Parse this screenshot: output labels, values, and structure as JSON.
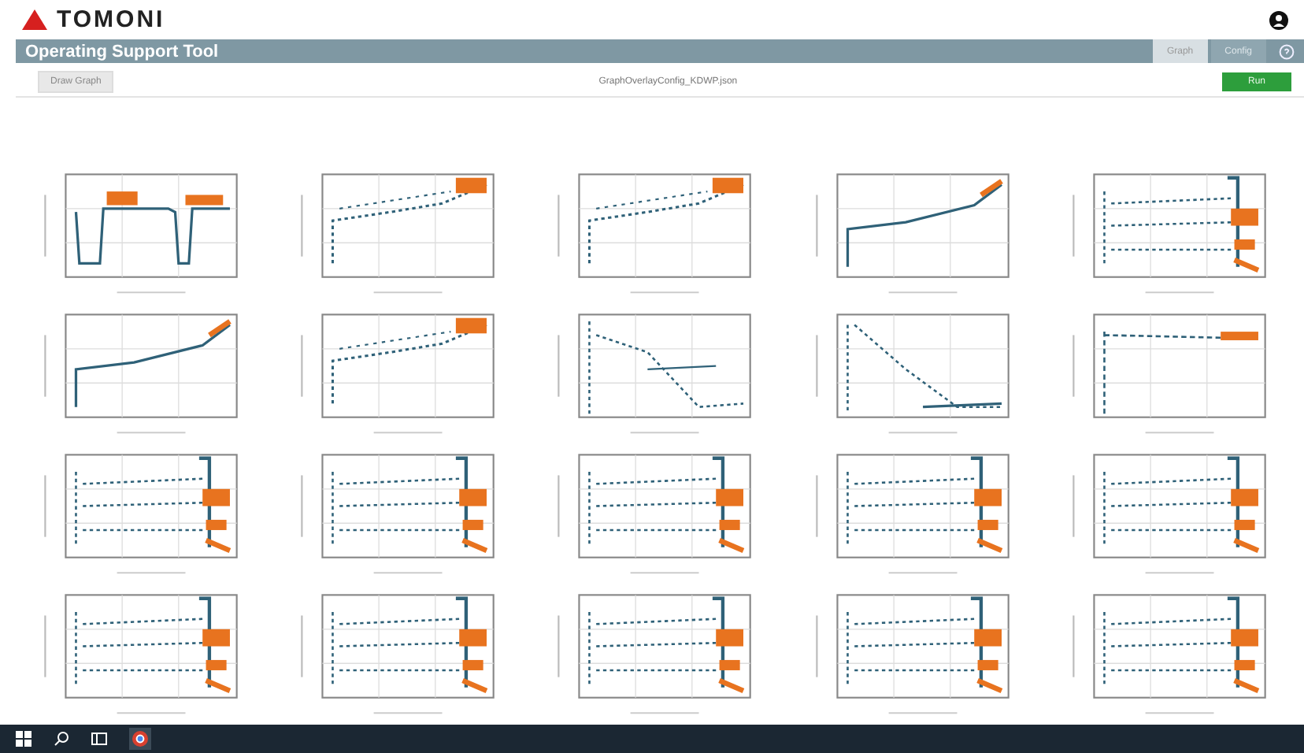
{
  "header": {
    "logo_text": "TOMONI"
  },
  "title_bar": {
    "title": "Operating Support Tool",
    "tabs": [
      {
        "label": "Graph",
        "selected": true
      },
      {
        "label": "Config",
        "selected": false
      }
    ]
  },
  "toolbar": {
    "draw_button": "Draw Graph",
    "config_file": "GraphOverlayConfig_KDWP.json",
    "run_button": "Run"
  }
}
